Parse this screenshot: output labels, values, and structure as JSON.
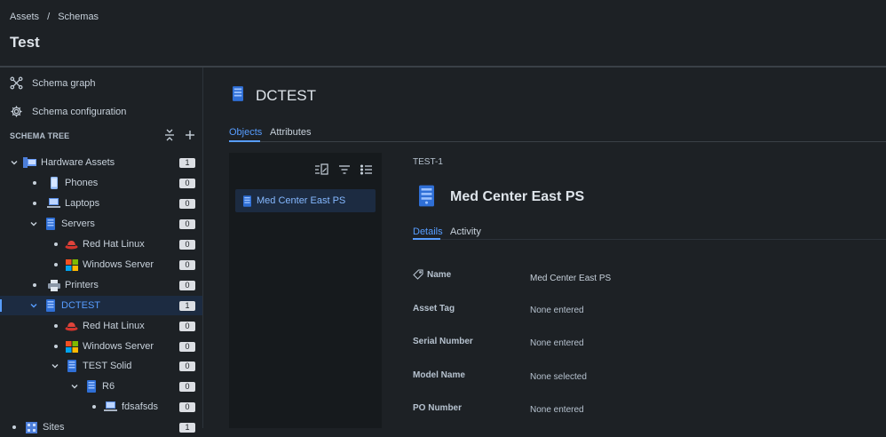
{
  "breadcrumb": {
    "assets": "Assets",
    "separator": "/",
    "schemas": "Schemas"
  },
  "page_title": "Test",
  "sidebar": {
    "links": [
      {
        "label": "Schema graph",
        "icon": "graph-icon"
      },
      {
        "label": "Schema configuration",
        "icon": "gear-icon"
      }
    ],
    "tree_label": "SCHEMA TREE",
    "tree": [
      {
        "label": "Hardware Assets",
        "count": "1",
        "icon": "hardware-assets-icon"
      },
      {
        "label": "Phones",
        "count": "0",
        "icon": "phone-icon"
      },
      {
        "label": "Laptops",
        "count": "0",
        "icon": "laptop-icon"
      },
      {
        "label": "Servers",
        "count": "0",
        "icon": "server-icon"
      },
      {
        "label": "Red Hat Linux",
        "count": "0",
        "icon": "redhat-icon"
      },
      {
        "label": "Windows Server",
        "count": "0",
        "icon": "windows-icon"
      },
      {
        "label": "Printers",
        "count": "0",
        "icon": "printer-icon"
      },
      {
        "label": "DCTEST",
        "count": "1",
        "icon": "server-icon"
      },
      {
        "label": "Red Hat Linux",
        "count": "0",
        "icon": "redhat-icon"
      },
      {
        "label": "Windows Server",
        "count": "0",
        "icon": "windows-icon"
      },
      {
        "label": "TEST Solid",
        "count": "0",
        "icon": "server-icon"
      },
      {
        "label": "R6",
        "count": "0",
        "icon": "server-icon"
      },
      {
        "label": "fdsafsds",
        "count": "0",
        "icon": "laptop-icon"
      },
      {
        "label": "Sites",
        "count": "1",
        "icon": "sites-icon"
      }
    ]
  },
  "main": {
    "title": "DCTEST",
    "tabs": [
      "Objects",
      "Attributes"
    ],
    "objects": [
      {
        "label": "Med Center East PS"
      }
    ]
  },
  "detail": {
    "key": "TEST-1",
    "title": "Med Center East PS",
    "tabs": [
      "Details",
      "Activity"
    ],
    "attributes": [
      {
        "label": "Name",
        "value": "Med Center East PS"
      },
      {
        "label": "Asset Tag",
        "value": "None entered"
      },
      {
        "label": "Serial Number",
        "value": "None entered"
      },
      {
        "label": "Model Name",
        "value": "None selected"
      },
      {
        "label": "PO Number",
        "value": "None entered"
      }
    ]
  },
  "colors": {
    "accent": "#579dff",
    "background": "#1d2125",
    "panel": "#161a1d",
    "selected": "#1c2b41"
  }
}
